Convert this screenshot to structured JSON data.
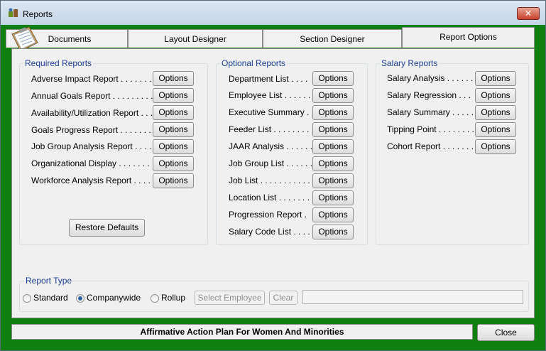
{
  "window": {
    "title": "Reports",
    "close_label": "✕"
  },
  "tabs": [
    {
      "label": "Documents"
    },
    {
      "label": "Layout Designer"
    },
    {
      "label": "Section Designer"
    },
    {
      "label": "Report Options",
      "active": true
    }
  ],
  "required": {
    "title": "Required Reports",
    "items": [
      {
        "label": "Adverse Impact Report . . . . . . . ."
      },
      {
        "label": "Annual Goals Report . . . . . . . . . ."
      },
      {
        "label": "Availability/Utilization Report . . ."
      },
      {
        "label": "Goals Progress Report . . . . . . . ."
      },
      {
        "label": "Job Group Analysis Report . . . ."
      },
      {
        "label": "Organizational Display . . . . . . . . ."
      },
      {
        "label": "Workforce Analysis Report . . . ."
      }
    ],
    "restore_label": "Restore Defaults"
  },
  "optional": {
    "title": "Optional Reports",
    "items": [
      {
        "label": "Department List . . . ."
      },
      {
        "label": "Employee List . . . . . . ."
      },
      {
        "label": "Executive Summary ."
      },
      {
        "label": "Feeder List . . . . . . . . . ."
      },
      {
        "label": "JAAR Analysis . . . . . . ."
      },
      {
        "label": "Job Group List . . . . . ."
      },
      {
        "label": "Job List . . . . . . . . . . . . ."
      },
      {
        "label": "Location List . . . . . . . ."
      },
      {
        "label": "Progression Report ."
      },
      {
        "label": "Salary Code List . . . ."
      }
    ]
  },
  "salary": {
    "title": "Salary Reports",
    "items": [
      {
        "label": "Salary Analysis . . . . . . ."
      },
      {
        "label": "Salary Regression . . ."
      },
      {
        "label": "Salary Summary . . . . . ."
      },
      {
        "label": "Tipping Point . . . . . . . . ."
      },
      {
        "label": "Cohort Report . . . . . . . ."
      }
    ]
  },
  "options_label": "Options",
  "report_type": {
    "title": "Report Type",
    "options": [
      {
        "label": "Standard",
        "checked": false
      },
      {
        "label": "Companywide",
        "checked": true
      },
      {
        "label": "Rollup",
        "checked": false
      }
    ],
    "select_employee_label": "Select Employee",
    "clear_label": "Clear",
    "employee_value": ""
  },
  "footer": {
    "plan_title": "Affirmative Action Plan For Women And Minorities",
    "close_label": "Close"
  },
  "colors": {
    "frame": "#0f7f0f",
    "group_title": "#1c3f94",
    "panel": "#f0f0f0"
  }
}
